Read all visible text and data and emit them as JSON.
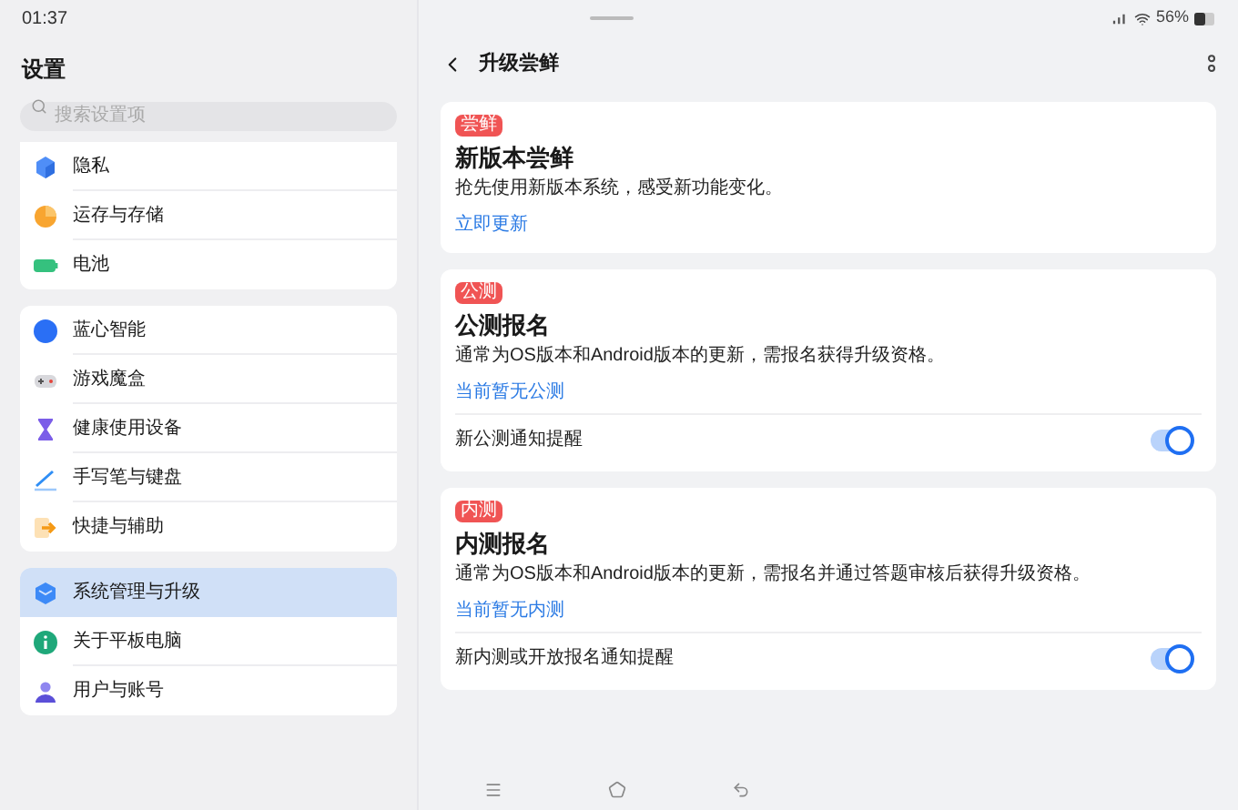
{
  "status_bar": {
    "time": "01:37",
    "battery": "56%"
  },
  "sidebar": {
    "title": "设置",
    "search": {
      "placeholder": "搜索设置项"
    },
    "groups": [
      {
        "items": [
          {
            "label": "隐私",
            "selected": false
          },
          {
            "label": "运存与存储",
            "selected": false
          },
          {
            "label": "电池",
            "selected": false
          }
        ]
      },
      {
        "items": [
          {
            "label": "蓝心智能",
            "selected": false
          },
          {
            "label": "游戏魔盒",
            "selected": false
          },
          {
            "label": "健康使用设备",
            "selected": false
          },
          {
            "label": "手写笔与键盘",
            "selected": false
          },
          {
            "label": "快捷与辅助",
            "selected": false
          }
        ]
      },
      {
        "items": [
          {
            "label": "系统管理与升级",
            "selected": true
          },
          {
            "label": "关于平板电脑",
            "selected": false
          },
          {
            "label": "用户与账号",
            "selected": false
          }
        ]
      }
    ]
  },
  "page": {
    "title": "升级尝鲜",
    "cards": [
      {
        "badge": "尝鲜",
        "title": "新版本尝鲜",
        "description": "抢先使用新版本系统，感受新功能变化。",
        "link": "立即更新"
      },
      {
        "badge": "公测",
        "title": "公测报名",
        "description": "通常为OS版本和Android版本的更新，需报名获得升级资格。",
        "link": "当前暂无公测",
        "toggle": {
          "label": "新公测通知提醒",
          "on": true
        }
      },
      {
        "badge": "内测",
        "title": "内测报名",
        "description": "通常为OS版本和Android版本的更新，需报名并通过答题审核后获得升级资格。",
        "link": "当前暂无内测",
        "toggle": {
          "label": "新内测或开放报名通知提醒",
          "on": true
        }
      }
    ]
  }
}
